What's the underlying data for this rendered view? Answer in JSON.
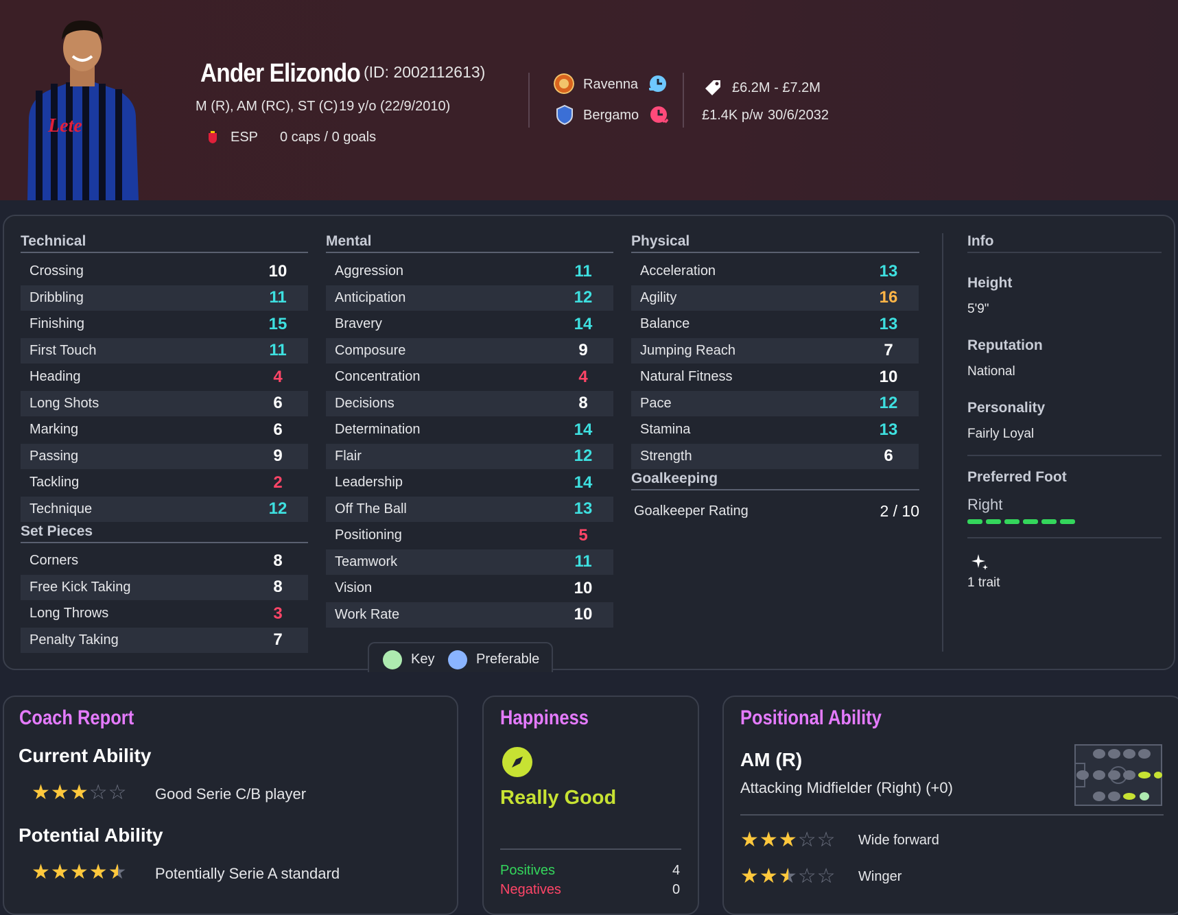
{
  "player": {
    "name": "Ander Elizondo",
    "id": "(ID: 2002112613)",
    "positions": "M (R), AM (RC), ST (C)",
    "age": "19 y/o (22/9/2010)",
    "nation": "ESP",
    "caps": "0 caps / 0 goals"
  },
  "clubs": {
    "current": "Ravenna",
    "parent": "Bergamo"
  },
  "contract": {
    "value": "£6.2M - £7.2M",
    "wage": "£1.4K p/w",
    "expiry": "30/6/2032"
  },
  "technical": {
    "title": "Technical",
    "rows": [
      {
        "label": "Crossing",
        "value": "10",
        "tone": "w"
      },
      {
        "label": "Dribbling",
        "value": "11",
        "tone": "c"
      },
      {
        "label": "Finishing",
        "value": "15",
        "tone": "c"
      },
      {
        "label": "First Touch",
        "value": "11",
        "tone": "c"
      },
      {
        "label": "Heading",
        "value": "4",
        "tone": "r"
      },
      {
        "label": "Long Shots",
        "value": "6",
        "tone": "w"
      },
      {
        "label": "Marking",
        "value": "6",
        "tone": "w"
      },
      {
        "label": "Passing",
        "value": "9",
        "tone": "w"
      },
      {
        "label": "Tackling",
        "value": "2",
        "tone": "r"
      },
      {
        "label": "Technique",
        "value": "12",
        "tone": "c"
      }
    ]
  },
  "setpieces": {
    "title": "Set Pieces",
    "rows": [
      {
        "label": "Corners",
        "value": "8",
        "tone": "w"
      },
      {
        "label": "Free Kick Taking",
        "value": "8",
        "tone": "w"
      },
      {
        "label": "Long Throws",
        "value": "3",
        "tone": "r"
      },
      {
        "label": "Penalty Taking",
        "value": "7",
        "tone": "w"
      }
    ]
  },
  "mental": {
    "title": "Mental",
    "rows": [
      {
        "label": "Aggression",
        "value": "11",
        "tone": "c"
      },
      {
        "label": "Anticipation",
        "value": "12",
        "tone": "c"
      },
      {
        "label": "Bravery",
        "value": "14",
        "tone": "c"
      },
      {
        "label": "Composure",
        "value": "9",
        "tone": "w"
      },
      {
        "label": "Concentration",
        "value": "4",
        "tone": "r"
      },
      {
        "label": "Decisions",
        "value": "8",
        "tone": "w"
      },
      {
        "label": "Determination",
        "value": "14",
        "tone": "c"
      },
      {
        "label": "Flair",
        "value": "12",
        "tone": "c"
      },
      {
        "label": "Leadership",
        "value": "14",
        "tone": "c"
      },
      {
        "label": "Off The Ball",
        "value": "13",
        "tone": "c"
      },
      {
        "label": "Positioning",
        "value": "5",
        "tone": "r"
      },
      {
        "label": "Teamwork",
        "value": "11",
        "tone": "c"
      },
      {
        "label": "Vision",
        "value": "10",
        "tone": "w"
      },
      {
        "label": "Work Rate",
        "value": "10",
        "tone": "w"
      }
    ]
  },
  "physical": {
    "title": "Physical",
    "rows": [
      {
        "label": "Acceleration",
        "value": "13",
        "tone": "c"
      },
      {
        "label": "Agility",
        "value": "16",
        "tone": "o"
      },
      {
        "label": "Balance",
        "value": "13",
        "tone": "c"
      },
      {
        "label": "Jumping Reach",
        "value": "7",
        "tone": "w"
      },
      {
        "label": "Natural Fitness",
        "value": "10",
        "tone": "w"
      },
      {
        "label": "Pace",
        "value": "12",
        "tone": "c"
      },
      {
        "label": "Stamina",
        "value": "13",
        "tone": "c"
      },
      {
        "label": "Strength",
        "value": "6",
        "tone": "w"
      }
    ]
  },
  "goalkeeping": {
    "title": "Goalkeeping",
    "label": "Goalkeeper Rating",
    "value": "2 / 10"
  },
  "info": {
    "title": "Info",
    "height_label": "Height",
    "height": "5'9\"",
    "reputation_label": "Reputation",
    "reputation": "National",
    "personality_label": "Personality",
    "personality": "Fairly Loyal",
    "foot_label": "Preferred Foot",
    "foot": "Right",
    "traits": "1 trait"
  },
  "key": {
    "key_label": "Key",
    "pref_label": "Preferable"
  },
  "coach": {
    "title": "Coach Report",
    "ca_label": "Current Ability",
    "ca_stars": 3,
    "ca_desc": "Good Serie C/B player",
    "pa_label": "Potential Ability",
    "pa_stars": 4.5,
    "pa_desc": "Potentially Serie A standard"
  },
  "happiness": {
    "title": "Happiness",
    "status": "Really Good",
    "positives_label": "Positives",
    "positives": "4",
    "negatives_label": "Negatives",
    "negatives": "0"
  },
  "positional": {
    "title": "Positional Ability",
    "position": "AM (R)",
    "detail": "Attacking Midfielder (Right) (+0)",
    "roles": [
      {
        "label": "Wide forward",
        "stars": 3
      },
      {
        "label": "Winger",
        "stars": 2.5
      }
    ]
  },
  "colors": {
    "cyan": "#3ee0e0",
    "red": "#ff4567",
    "orange": "#ffb547",
    "accent": "#e57bff",
    "green": "#34d65c"
  }
}
